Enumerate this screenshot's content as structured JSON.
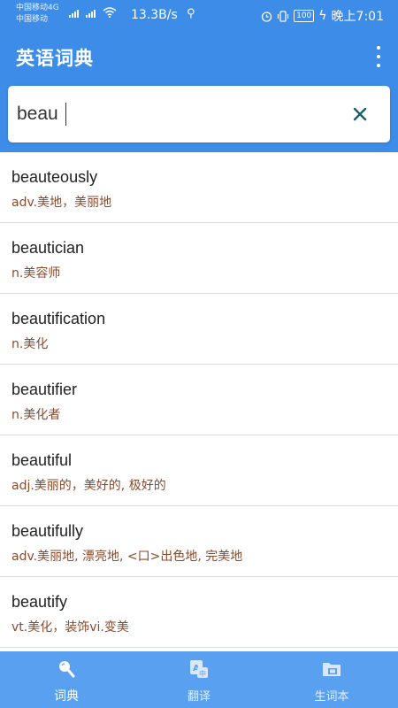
{
  "status_bar": {
    "carrier_line1": "中国移动4G",
    "carrier_line2": "中国移动",
    "net_tag": "4G",
    "speed": "13.3B/s",
    "battery": "100",
    "time": "晚上7:01"
  },
  "app_bar": {
    "title": "英语词典"
  },
  "search": {
    "value": "beau",
    "placeholder": ""
  },
  "results": [
    {
      "word": "beauteously",
      "meaning": "adv.美地，美丽地"
    },
    {
      "word": "beautician",
      "meaning": "n.美容师"
    },
    {
      "word": "beautification",
      "meaning": "n.美化"
    },
    {
      "word": "beautifier",
      "meaning": "n.美化者"
    },
    {
      "word": "beautiful",
      "meaning": "adj.美丽的，美好的, 极好的"
    },
    {
      "word": "beautifully",
      "meaning": "adv.美丽地, 漂亮地, <口>出色地, 完美地"
    },
    {
      "word": "beautify",
      "meaning": "vt.美化，装饰vi.变美"
    }
  ],
  "nav": [
    {
      "label": "词典",
      "icon": "search-icon"
    },
    {
      "label": "翻译",
      "icon": "translate-icon"
    },
    {
      "label": "生词本",
      "icon": "folder-icon"
    }
  ],
  "colors": {
    "primary": "#3d8ce8",
    "nav_bg": "#5aa0f0",
    "meaning_text": "#8b4a2b",
    "clear_icon": "#1a5c6e"
  }
}
